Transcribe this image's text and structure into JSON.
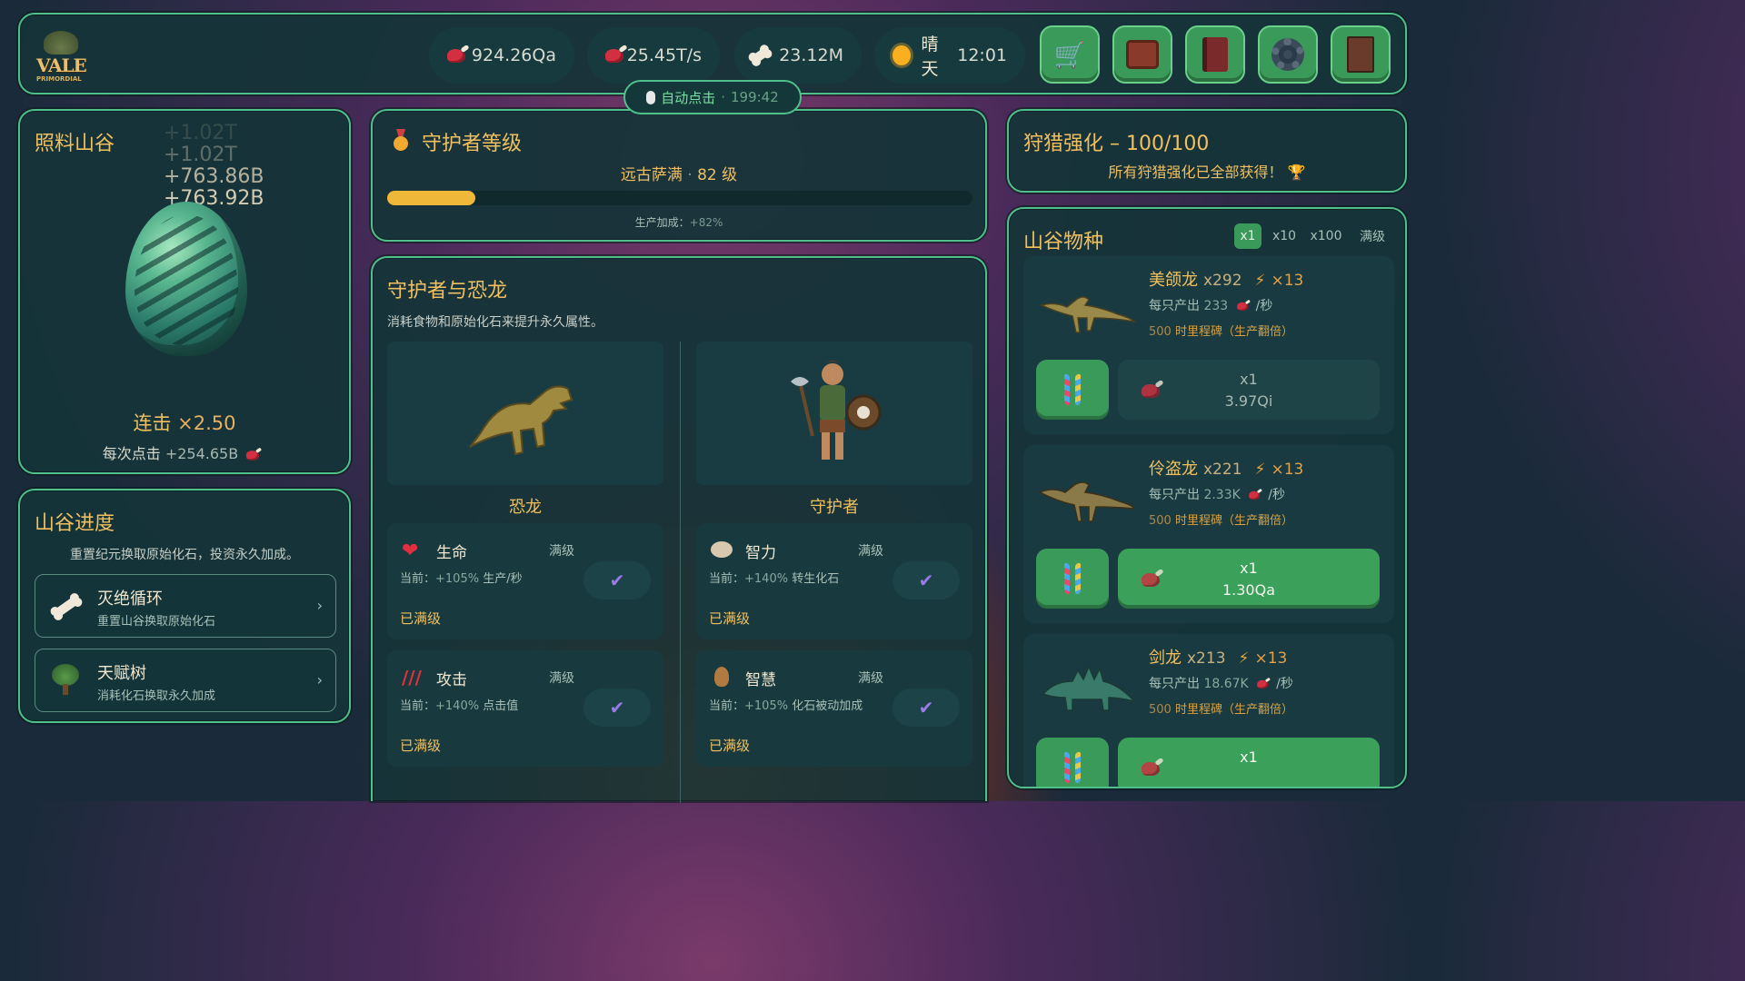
{
  "brand": {
    "logo_text": "VALE",
    "logo_sub": "PRIMORDIAL"
  },
  "stats": {
    "food": "924.26Qa",
    "rate": "25.45T/s",
    "fossils": "23.12M",
    "weather": "晴天",
    "time": "12:01"
  },
  "top_buttons": [
    "shop-cart-icon",
    "treasure-chest-icon",
    "book-icon",
    "gear-icon",
    "journal-icon"
  ],
  "autoclick": {
    "label": "自动点击",
    "timer": "199:42"
  },
  "feed": {
    "title": "照料山谷",
    "floats": [
      "+1.02T",
      "+1.02T",
      "+763.86B",
      "+763.92B"
    ],
    "combo_label": "连击",
    "combo_value": "×2.50",
    "per_click_label": "每次点击",
    "per_click_value": "+254.65B"
  },
  "progress": {
    "title": "山谷进度",
    "desc": "重置纪元换取原始化石，投资永久加成。",
    "items": [
      {
        "title": "灭绝循环",
        "sub": "重置山谷换取原始化石",
        "chev": "›"
      },
      {
        "title": "天赋树",
        "sub": "消耗化石换取永久加成",
        "chev": "›"
      }
    ]
  },
  "guardian_level": {
    "title": "守护者等级",
    "rank": "远古萨满",
    "sep": "·",
    "level": "82 级",
    "progress": 0.15,
    "bonus_label": "生产加成：",
    "bonus_value": "+82%"
  },
  "guardian_dino": {
    "title": "守护者与恐龙",
    "desc": "消耗食物和原始化石来提升永久属性。",
    "dino_label": "恐龙",
    "guardian_label": "守护者",
    "stats": [
      {
        "name": "生命",
        "max": "满级",
        "cur_label": "当前：",
        "cur_value": "+105%",
        "cur_unit": "生产/秒",
        "done": "已满级",
        "icon": "heart-icon"
      },
      {
        "name": "智力",
        "max": "满级",
        "cur_label": "当前：",
        "cur_value": "+140%",
        "cur_unit": "转生化石",
        "done": "已满级",
        "icon": "brain-icon"
      },
      {
        "name": "攻击",
        "max": "满级",
        "cur_label": "当前：",
        "cur_value": "+140%",
        "cur_unit": "点击值",
        "done": "已满级",
        "icon": "claw-icon"
      },
      {
        "name": "智慧",
        "max": "满级",
        "cur_label": "当前：",
        "cur_value": "+105%",
        "cur_unit": "化石被动加成",
        "done": "已满级",
        "icon": "owl-icon"
      }
    ]
  },
  "hunt": {
    "title": "狩猎强化",
    "dash": "–",
    "count": "100/100",
    "msg": "所有狩猎强化已全部获得！"
  },
  "species": {
    "title": "山谷物种",
    "multipliers": [
      "x1",
      "x10",
      "x100",
      "满级"
    ],
    "active_multiplier": 0,
    "list": [
      {
        "name": "美颌龙",
        "count": "x292",
        "boost": "×13",
        "prod_label": "每只产出",
        "prod_value": "233",
        "prod_unit": "/秒",
        "milestone_num": "500",
        "milestone": "时里程碑（生产翻倍）",
        "buy_qty": "x1",
        "buy_cost": "3.97Qi",
        "affordable": false
      },
      {
        "name": "伶盗龙",
        "count": "x221",
        "boost": "×13",
        "prod_label": "每只产出",
        "prod_value": "2.33K",
        "prod_unit": "/秒",
        "milestone_num": "500",
        "milestone": "时里程碑（生产翻倍）",
        "buy_qty": "x1",
        "buy_cost": "1.30Qa",
        "affordable": true
      },
      {
        "name": "剑龙",
        "count": "x213",
        "boost": "×13",
        "prod_label": "每只产出",
        "prod_value": "18.67K",
        "prod_unit": "/秒",
        "milestone_num": "500",
        "milestone": "时里程碑（生产翻倍）",
        "buy_qty": "x1",
        "buy_cost": "",
        "affordable": true
      }
    ]
  },
  "colors": {
    "accent": "#4fc08a",
    "gold": "#f0c060",
    "panel": "#143438",
    "button": "#3a9a5a",
    "progress": "#f0b838"
  }
}
